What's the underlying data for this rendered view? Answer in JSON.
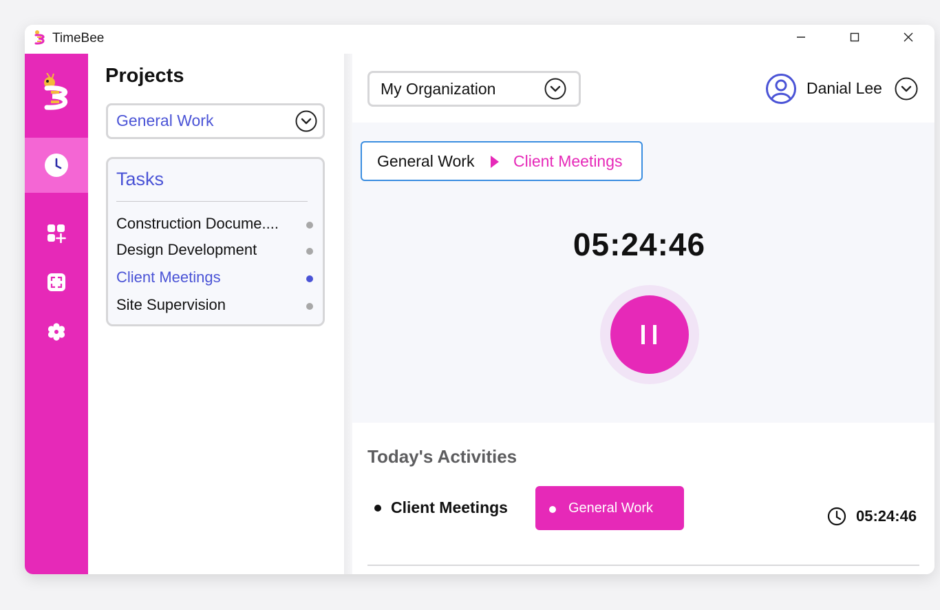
{
  "app": {
    "title": "TimeBee",
    "accent": "#e629b8",
    "link_color": "#4a53d6"
  },
  "rail": {
    "items": [
      {
        "icon": "clock-icon",
        "active": true
      },
      {
        "icon": "add-apps-icon",
        "active": false
      },
      {
        "icon": "screenshot-icon",
        "active": false
      },
      {
        "icon": "gear-icon",
        "active": false
      }
    ]
  },
  "projects": {
    "title": "Projects",
    "selected": "General Work",
    "tasks_title": "Tasks",
    "tasks": [
      {
        "label": "Construction Docume....",
        "active": false
      },
      {
        "label": "Design Development",
        "active": false
      },
      {
        "label": "Client Meetings",
        "active": true
      },
      {
        "label": "Site Supervision",
        "active": false
      }
    ]
  },
  "header": {
    "organization": "My Organization",
    "user_name": "Danial Lee"
  },
  "timer": {
    "breadcrumb_project": "General Work",
    "breadcrumb_task": "Client Meetings",
    "elapsed": "05:24:46",
    "state": "running"
  },
  "activities": {
    "title": "Today's Activities",
    "items": [
      {
        "task": "Client Meetings",
        "project": "General Work",
        "duration": "05:24:46"
      }
    ]
  }
}
